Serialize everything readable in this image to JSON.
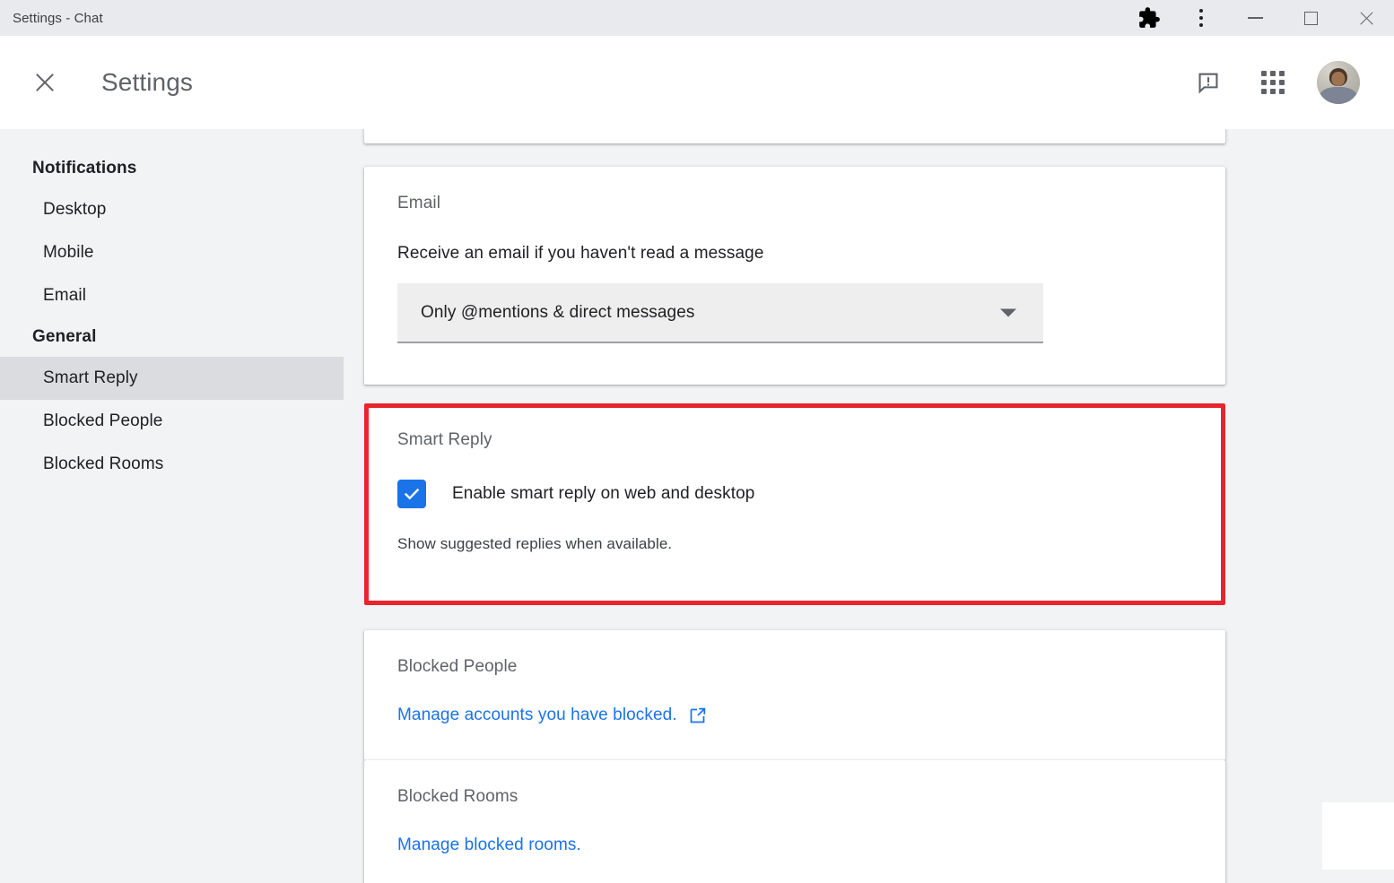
{
  "window": {
    "title": "Settings - Chat",
    "controls": {
      "extensions": "extensions-puzzle-icon",
      "menu": "three-dot-menu-icon",
      "minimize": "minimize-icon",
      "maximize": "maximize-icon",
      "close": "close-icon"
    }
  },
  "header": {
    "close_label": "close-settings-icon",
    "title": "Settings",
    "feedback_icon": "feedback-icon",
    "apps_icon": "apps-grid-icon",
    "avatar_label": "user-avatar"
  },
  "sidebar": {
    "sections": [
      {
        "label": "Notifications",
        "items": [
          {
            "label": "Desktop",
            "selected": false
          },
          {
            "label": "Mobile",
            "selected": false
          },
          {
            "label": "Email",
            "selected": false
          }
        ]
      },
      {
        "label": "General",
        "items": [
          {
            "label": "Smart Reply",
            "selected": true
          },
          {
            "label": "Blocked People",
            "selected": false
          },
          {
            "label": "Blocked Rooms",
            "selected": false
          }
        ]
      }
    ]
  },
  "main": {
    "email_card": {
      "title": "Email",
      "description": "Receive an email if you haven't read a message",
      "select_value": "Only @mentions & direct messages",
      "select_arrow_icon": "chevron-down-icon"
    },
    "smart_reply_card": {
      "title": "Smart Reply",
      "checkbox_label": "Enable smart reply on web and desktop",
      "checkbox_checked": true,
      "helper_text": "Show suggested replies when available.",
      "highlight_color": "#e8252c"
    },
    "blocked_people_card": {
      "title": "Blocked People",
      "link_text": "Manage accounts you have blocked.",
      "link_icon": "external-link-icon"
    },
    "blocked_rooms_card": {
      "title": "Blocked Rooms",
      "link_text": "Manage blocked rooms."
    }
  },
  "colors": {
    "accent": "#1a73e8",
    "checkbox": "#1b73e8",
    "highlight": "#e8252c",
    "sidebar_selected": "#dadce0",
    "page_background": "#f1f3f4"
  }
}
